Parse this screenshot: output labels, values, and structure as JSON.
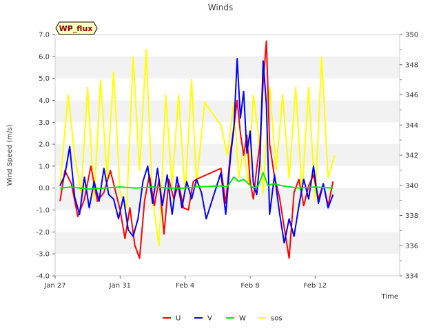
{
  "chart_data": {
    "type": "line",
    "title": "Winds",
    "xlabel": "Time",
    "ylabel": "Wind Speed (m/s)",
    "badge": "WP_flux",
    "x_unit": "days",
    "xlim": [
      0,
      21.2
    ],
    "ylim": [
      -4.0,
      7.0
    ],
    "y2lim": [
      334,
      350
    ],
    "x_ticks": [
      {
        "label": "Jan 27",
        "value": 0
      },
      {
        "label": "Jan 31",
        "value": 4
      },
      {
        "label": "Feb 4",
        "value": 8
      },
      {
        "label": "Feb 8",
        "value": 12
      },
      {
        "label": "Feb 12",
        "value": 16
      }
    ],
    "y_ticks": [
      "-4.0",
      "-3.0",
      "-2.0",
      "-1.0",
      "0.0",
      "1.0",
      "2.0",
      "3.0",
      "4.0",
      "5.0",
      "6.0",
      "7.0"
    ],
    "y2_ticks": [
      "334",
      "336",
      "338",
      "340",
      "342",
      "344",
      "346",
      "348",
      "350"
    ],
    "grid": "horizontal bands",
    "legend_position": "bottom",
    "series": [
      {
        "name": "U",
        "axis": "left",
        "color": "#ff0000",
        "x": [
          0.3,
          0.6,
          1.0,
          1.4,
          1.8,
          2.2,
          2.6,
          3.0,
          3.4,
          3.8,
          4.0,
          4.3,
          4.6,
          4.9,
          5.2,
          5.5,
          5.8,
          6.1,
          6.4,
          6.7,
          7.0,
          7.3,
          7.6,
          7.9,
          8.2,
          8.5,
          8.7,
          10.2,
          10.5,
          10.8,
          11.0,
          11.2,
          11.4,
          11.6,
          11.8,
          12.0,
          12.2,
          12.4,
          12.6,
          12.8,
          13.0,
          13.2,
          13.5,
          13.8,
          14.1,
          14.4,
          14.7,
          15.0,
          15.3,
          15.6,
          15.9,
          16.2,
          16.5,
          16.8,
          17.1
        ],
        "values": [
          -0.6,
          0.8,
          0.2,
          -1.3,
          -0.5,
          1.0,
          -0.6,
          -0.2,
          0.8,
          -0.4,
          -1.0,
          -2.3,
          -0.9,
          -2.6,
          -3.2,
          -0.6,
          0.6,
          -0.8,
          0.4,
          -2.1,
          0.4,
          -0.5,
          0.2,
          -0.9,
          -1.0,
          0.3,
          0.4,
          0.9,
          -0.7,
          1.7,
          2.8,
          4.0,
          2.5,
          1.5,
          2.4,
          0.3,
          -0.5,
          0.9,
          2.0,
          4.8,
          6.7,
          2.0,
          0.5,
          -0.4,
          -1.8,
          -3.2,
          -0.2,
          0.4,
          -0.8,
          0.1,
          0.6,
          -0.5,
          0.2,
          -0.8,
          0.3
        ]
      },
      {
        "name": "V",
        "axis": "left",
        "color": "#0000ff",
        "x": [
          0.3,
          0.6,
          0.9,
          1.2,
          1.5,
          1.8,
          2.1,
          2.4,
          2.7,
          3.0,
          3.3,
          3.6,
          3.9,
          4.2,
          4.5,
          4.8,
          5.1,
          5.4,
          5.7,
          6.0,
          6.3,
          6.6,
          6.9,
          7.2,
          7.5,
          7.8,
          8.1,
          8.4,
          8.7,
          9.0,
          9.3,
          10.2,
          10.5,
          10.8,
          11.0,
          11.2,
          11.4,
          11.6,
          11.8,
          12.0,
          12.2,
          12.4,
          12.6,
          12.8,
          13.0,
          13.2,
          13.5,
          13.8,
          14.1,
          14.4,
          14.7,
          15.0,
          15.3,
          15.6,
          15.9,
          16.2,
          16.5,
          16.8,
          17.1
        ],
        "values": [
          0.1,
          0.6,
          1.9,
          -0.4,
          -1.2,
          0.5,
          -0.9,
          0.3,
          -0.6,
          0.9,
          -0.3,
          -0.5,
          -1.4,
          -0.4,
          -1.9,
          -2.2,
          -1.4,
          0.3,
          1.0,
          -0.7,
          0.9,
          -0.8,
          0.6,
          -1.2,
          0.5,
          -0.9,
          0.3,
          -0.5,
          0.4,
          -0.2,
          -1.4,
          0.7,
          -1.2,
          1.5,
          2.7,
          5.9,
          3.2,
          4.4,
          1.6,
          2.6,
          0.2,
          -0.3,
          1.2,
          5.8,
          3.8,
          -1.2,
          0.6,
          -1.1,
          -2.5,
          -1.4,
          -2.2,
          -0.8,
          0.4,
          -0.5,
          1.0,
          -0.7,
          0.2,
          -0.9,
          -0.3
        ]
      },
      {
        "name": "W",
        "axis": "left",
        "color": "#00ee00",
        "x": [
          0.3,
          1.0,
          2.0,
          3.0,
          4.0,
          5.0,
          6.0,
          7.0,
          8.0,
          8.7,
          10.2,
          10.6,
          11.0,
          11.3,
          11.6,
          11.9,
          12.2,
          12.5,
          12.8,
          13.1,
          13.4,
          14.0,
          15.0,
          16.0,
          17.1
        ],
        "values": [
          0.0,
          0.05,
          -0.05,
          0.0,
          0.05,
          0.0,
          0.05,
          0.0,
          0.0,
          0.05,
          0.1,
          0.05,
          0.5,
          0.3,
          0.4,
          0.2,
          0.0,
          0.1,
          0.7,
          0.1,
          0.2,
          0.1,
          0.0,
          0.05,
          0.0
        ]
      },
      {
        "name": "sos",
        "axis": "right",
        "color": "#ffff00",
        "x": [
          0.3,
          0.8,
          1.2,
          1.6,
          2.0,
          2.4,
          2.8,
          3.2,
          3.6,
          4.0,
          4.4,
          4.8,
          5.2,
          5.6,
          6.0,
          6.4,
          6.8,
          7.2,
          7.6,
          8.0,
          8.4,
          8.7,
          9.2,
          10.2,
          10.6,
          11.0,
          11.3,
          11.6,
          11.9,
          12.2,
          12.5,
          12.8,
          13.2,
          13.6,
          14.0,
          14.4,
          14.8,
          15.2,
          15.6,
          16.0,
          16.4,
          16.8,
          17.2
        ],
        "values": [
          340.0,
          346.0,
          342.0,
          339.5,
          346.5,
          339.0,
          347.0,
          340.5,
          347.5,
          339.5,
          338.5,
          348.5,
          341.0,
          349.0,
          339.0,
          336.0,
          346.0,
          340.0,
          346.0,
          339.5,
          347.0,
          340.0,
          345.5,
          344.0,
          342.0,
          345.5,
          340.5,
          342.5,
          340.0,
          346.0,
          343.5,
          339.5,
          346.5,
          341.0,
          346.0,
          340.5,
          346.5,
          339.5,
          346.5,
          339.0,
          348.5,
          340.5,
          342.0
        ]
      }
    ]
  }
}
